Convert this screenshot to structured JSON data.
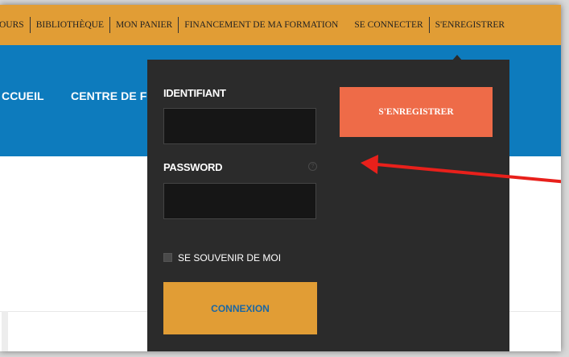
{
  "topbar": {
    "items": [
      "OURS",
      "BIBLIOTHÈQUE",
      "MON PANIER",
      "FINANCEMENT DE MA FORMATION",
      "SE CONNECTER",
      "S'ENREGISTRER"
    ]
  },
  "navbar": {
    "items": [
      "CCUEIL",
      "CENTRE DE FORMATION"
    ]
  },
  "login": {
    "username_label": "IDENTIFIANT",
    "username_value": "",
    "password_label": "PASSWORD",
    "password_value": "",
    "remember_label": "SE SOUVENIR DE MOI",
    "remember_checked": false,
    "submit_label": "CONNEXION",
    "register_label": "S'ENREGISTRER"
  },
  "annotation": {
    "arrow_color": "#e8201b"
  },
  "colors": {
    "topbar": "#e19d35",
    "navbar": "#0d7bbd",
    "dropdown": "#2b2b2b",
    "register_button": "#ee6b48",
    "login_button": "#e19d35"
  }
}
